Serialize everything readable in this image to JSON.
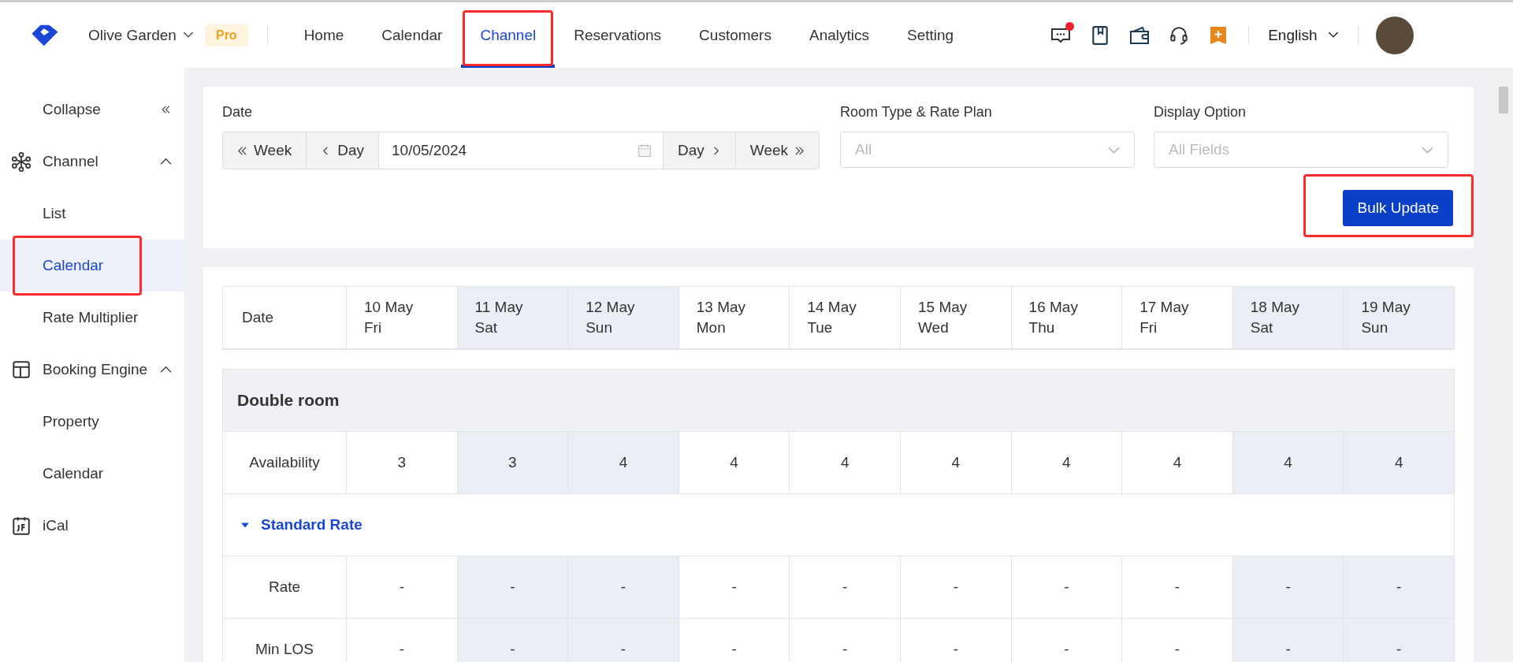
{
  "header": {
    "property": "Olive Garden",
    "plan_badge": "Pro",
    "unread": true,
    "language": "English",
    "nav": [
      {
        "label": "Home",
        "selected": false,
        "highlighted": false
      },
      {
        "label": "Calendar",
        "selected": false,
        "highlighted": false
      },
      {
        "label": "Channel",
        "selected": true,
        "highlighted": true
      },
      {
        "label": "Reservations",
        "selected": false,
        "highlighted": false
      },
      {
        "label": "Customers",
        "selected": false,
        "highlighted": false
      },
      {
        "label": "Analytics",
        "selected": false,
        "highlighted": false
      },
      {
        "label": "Setting",
        "selected": false,
        "highlighted": false
      }
    ]
  },
  "sidebar": {
    "collapse": "Collapse",
    "groups": [
      {
        "label": "Channel",
        "expanded": true,
        "children": [
          {
            "label": "List",
            "selected": false,
            "highlighted": false
          },
          {
            "label": "Calendar",
            "selected": true,
            "highlighted": true
          },
          {
            "label": "Rate Multiplier",
            "selected": false,
            "highlighted": false
          }
        ]
      },
      {
        "label": "Booking Engine",
        "expanded": true,
        "children": [
          {
            "label": "Property",
            "selected": false,
            "highlighted": false
          },
          {
            "label": "Calendar",
            "selected": false,
            "highlighted": false
          }
        ]
      },
      {
        "label": "iCal"
      }
    ]
  },
  "filters": {
    "date": {
      "label": "Date",
      "prev": [
        "Week",
        "Day"
      ],
      "value": "10/05/2024",
      "next": [
        "Day",
        "Week"
      ]
    },
    "room_type": {
      "label": "Room Type & Rate Plan",
      "placeholder": "All"
    },
    "display": {
      "label": "Display Option",
      "placeholder": "All Fields"
    },
    "bulk_update": {
      "label": "Bulk Update",
      "highlighted": true
    }
  },
  "table": {
    "date_header": "Date",
    "columns": [
      {
        "date": "10 May",
        "day": "Fri",
        "weekend": false
      },
      {
        "date": "11 May",
        "day": "Sat",
        "weekend": true
      },
      {
        "date": "12 May",
        "day": "Sun",
        "weekend": true
      },
      {
        "date": "13 May",
        "day": "Mon",
        "weekend": false
      },
      {
        "date": "14 May",
        "day": "Tue",
        "weekend": false
      },
      {
        "date": "15 May",
        "day": "Wed",
        "weekend": false
      },
      {
        "date": "16 May",
        "day": "Thu",
        "weekend": false
      },
      {
        "date": "17 May",
        "day": "Fri",
        "weekend": false
      },
      {
        "date": "18 May",
        "day": "Sat",
        "weekend": true
      },
      {
        "date": "19 May",
        "day": "Sun",
        "weekend": true
      }
    ],
    "groups": [
      {
        "name": "Double room",
        "rows": [
          {
            "label": "Availability",
            "values": [
              "3",
              "3",
              "4",
              "4",
              "4",
              "4",
              "4",
              "4",
              "4",
              "4"
            ]
          }
        ],
        "rate_plans": [
          {
            "name": "Standard Rate",
            "expanded": true,
            "rows": [
              {
                "label": "Rate",
                "values": [
                  "-",
                  "-",
                  "-",
                  "-",
                  "-",
                  "-",
                  "-",
                  "-",
                  "-",
                  "-"
                ]
              },
              {
                "label": "Min LOS",
                "values": [
                  "-",
                  "-",
                  "-",
                  "-",
                  "-",
                  "-",
                  "-",
                  "-",
                  "-",
                  "-"
                ]
              }
            ]
          }
        ]
      }
    ]
  }
}
